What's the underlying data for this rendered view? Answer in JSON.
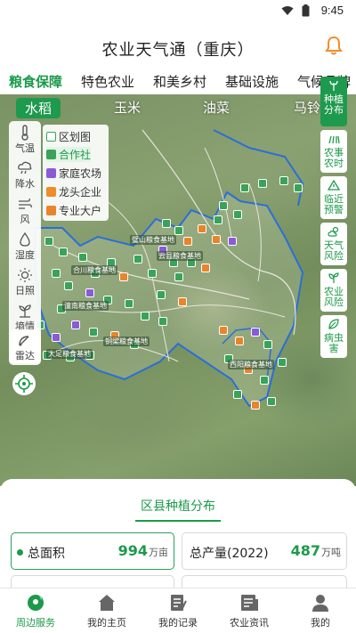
{
  "status": {
    "time": "9:45"
  },
  "header": {
    "title": "农业天气通（重庆）"
  },
  "category_tabs": [
    "粮食保障",
    "特色农业",
    "和美乡村",
    "基础设施",
    "气候品牌"
  ],
  "crop_tabs": [
    "水稻",
    "玉米",
    "油菜",
    "马铃薯"
  ],
  "weather_tools": [
    "气温",
    "降水",
    "风",
    "湿度",
    "日照",
    "墒情"
  ],
  "radar": "雷达",
  "legend": [
    "区划图",
    "合作社",
    "家庭农场",
    "龙头企业",
    "专业大户"
  ],
  "legend_colors": {
    "cooperative": "#3aa35a",
    "family_farm": "#8a5bd6",
    "leading_enterprise": "#f08c2a",
    "large_grower": "#e8852a"
  },
  "right_panel": [
    {
      "label": "种植分布"
    },
    {
      "label": "农事农时"
    },
    {
      "label": "临近预警"
    },
    {
      "label": "天气风险"
    },
    {
      "label": "农业风险"
    },
    {
      "label": "病虫害"
    }
  ],
  "base_labels": [
    "璧山粮食基地",
    "云县粮食基地",
    "合川粮食基地",
    "潼南粮食基地",
    "铜梁粮食基地",
    "大足粮食基地",
    "西阳粮食基地"
  ],
  "summary": {
    "title": "区县种植分布",
    "area_label": "总面积",
    "area_value": "994",
    "area_unit": "万亩",
    "output_label": "总产量(2022)",
    "output_value": "487",
    "output_unit": "万吨"
  },
  "bottom_nav": [
    "周边服务",
    "我的主页",
    "我的记录",
    "农业资讯",
    "我的"
  ],
  "accent": "#1c9a4a"
}
